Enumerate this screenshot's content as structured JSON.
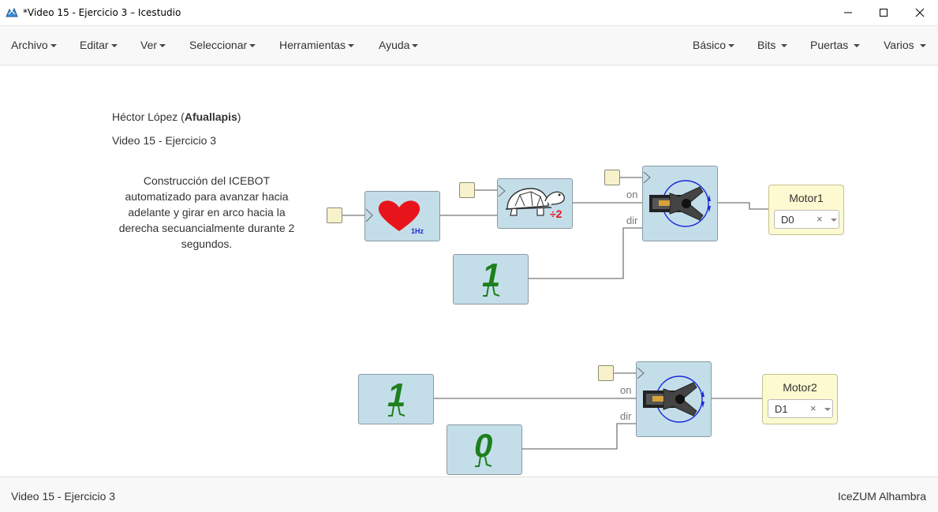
{
  "window": {
    "title": "*Video 15 - Ejercicio 3 – Icestudio",
    "app_icon": "icestudio-logo-icon",
    "controls": [
      "minimize-icon",
      "maximize-icon",
      "close-icon"
    ]
  },
  "menu": {
    "left": [
      "Archivo",
      "Editar",
      "Ver",
      "Seleccionar",
      "Herramientas",
      "Ayuda"
    ],
    "right": [
      "Básico",
      "Bits",
      "Puertas",
      "Varios"
    ]
  },
  "canvas": {
    "author_prefix": "Héctor López (",
    "author_nick": "Afuallapis",
    "author_suffix": ")",
    "subtitle": "Video 15 - Ejercicio 3",
    "description": "Construcción del ICEBOT automatizado para avanzar hacia adelante y girar en arco hacia la derecha secuancialmente durante 2 segundos.",
    "heart_label": "1Hz",
    "divider_label": "÷2",
    "const_one_a": "1",
    "const_one_b": "1",
    "const_zero": "0",
    "servo1_on": "on",
    "servo1_dir": "dir",
    "servo2_on": "on",
    "servo2_dir": "dir",
    "motor1_title": "Motor1",
    "motor1_pin": "D0",
    "motor2_title": "Motor2",
    "motor2_pin": "D1",
    "clear_symbol": "×"
  },
  "footer": {
    "left": "Video 15 - Ejercicio 3",
    "right": "IceZUM Alhambra"
  },
  "colors": {
    "block_bg": "#c3dee9",
    "io_bg": "#fdfad1",
    "heart": "#e8141c",
    "digit_green": "#1d7f1d",
    "servo_circle": "#1a28d8"
  }
}
